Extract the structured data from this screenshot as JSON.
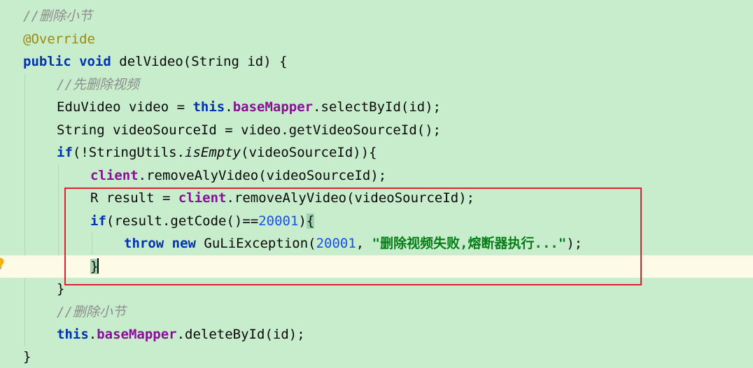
{
  "editor": {
    "lines": [
      {
        "id": "l1",
        "tokens": [
          {
            "t": "comment",
            "v": "//删除小节"
          }
        ]
      },
      {
        "id": "l2",
        "tokens": [
          {
            "t": "annot",
            "v": "@Override"
          }
        ]
      },
      {
        "id": "l3",
        "tokens": [
          {
            "t": "kw",
            "v": "public"
          },
          {
            "t": "plain",
            "v": " "
          },
          {
            "t": "kw",
            "v": "void"
          },
          {
            "t": "plain",
            "v": " delVideo(String id) {"
          }
        ]
      },
      {
        "id": "l4",
        "tokens": [
          {
            "t": "comment",
            "v": "//先删除视频"
          }
        ]
      },
      {
        "id": "l5",
        "tokens": [
          {
            "t": "plain",
            "v": "EduVideo video = "
          },
          {
            "t": "kw",
            "v": "this"
          },
          {
            "t": "plain",
            "v": "."
          },
          {
            "t": "field",
            "v": "baseMapper"
          },
          {
            "t": "plain",
            "v": ".selectById(id);"
          }
        ]
      },
      {
        "id": "l6",
        "tokens": [
          {
            "t": "plain",
            "v": "String videoSourceId = video.getVideoSourceId();"
          }
        ]
      },
      {
        "id": "l7",
        "tokens": [
          {
            "t": "kw",
            "v": "if"
          },
          {
            "t": "plain",
            "v": "(!StringUtils."
          },
          {
            "t": "italic",
            "v": "isEmpty"
          },
          {
            "t": "plain",
            "v": "(videoSourceId)){"
          }
        ]
      },
      {
        "id": "l8",
        "tokens": [
          {
            "t": "field",
            "v": "client"
          },
          {
            "t": "plain",
            "v": ".removeAlyVideo(videoSourceId);"
          }
        ]
      },
      {
        "id": "l9",
        "tokens": [
          {
            "t": "plain",
            "v": "R result = "
          },
          {
            "t": "field",
            "v": "client"
          },
          {
            "t": "plain",
            "v": ".removeAlyVideo(videoSourceId);"
          }
        ]
      },
      {
        "id": "l10",
        "tokens": [
          {
            "t": "kw",
            "v": "if"
          },
          {
            "t": "plain",
            "v": "(result.getCode()=="
          },
          {
            "t": "num",
            "v": "20001"
          },
          {
            "t": "plain",
            "v": ")"
          },
          {
            "t": "bracehl",
            "v": "{"
          }
        ]
      },
      {
        "id": "l11",
        "tokens": [
          {
            "t": "kw",
            "v": "throw"
          },
          {
            "t": "plain",
            "v": " "
          },
          {
            "t": "kw",
            "v": "new"
          },
          {
            "t": "plain",
            "v": " GuLiException("
          },
          {
            "t": "num",
            "v": "20001"
          },
          {
            "t": "plain",
            "v": ", "
          },
          {
            "t": "str",
            "v": "\"删除视频失败,熔断器执行...\""
          },
          {
            "t": "plain",
            "v": ");"
          }
        ]
      },
      {
        "id": "l12",
        "tokens": [
          {
            "t": "bracehl",
            "v": "}"
          }
        ]
      },
      {
        "id": "l13",
        "tokens": [
          {
            "t": "plain",
            "v": "}"
          }
        ]
      },
      {
        "id": "l14",
        "tokens": [
          {
            "t": "comment",
            "v": "//删除小节"
          }
        ]
      },
      {
        "id": "l15",
        "tokens": [
          {
            "t": "kw",
            "v": "this"
          },
          {
            "t": "plain",
            "v": "."
          },
          {
            "t": "field",
            "v": "baseMapper"
          },
          {
            "t": "plain",
            "v": ".deleteById(id);"
          }
        ]
      },
      {
        "id": "l16",
        "tokens": [
          {
            "t": "plain",
            "v": "}"
          }
        ]
      }
    ],
    "current_line_id": "l12",
    "gutter_icon": "lightbulb-icon"
  },
  "colors": {
    "background": "#c7edcc",
    "current_line": "#fdfbe6",
    "highlight_box": "#e0202a"
  }
}
